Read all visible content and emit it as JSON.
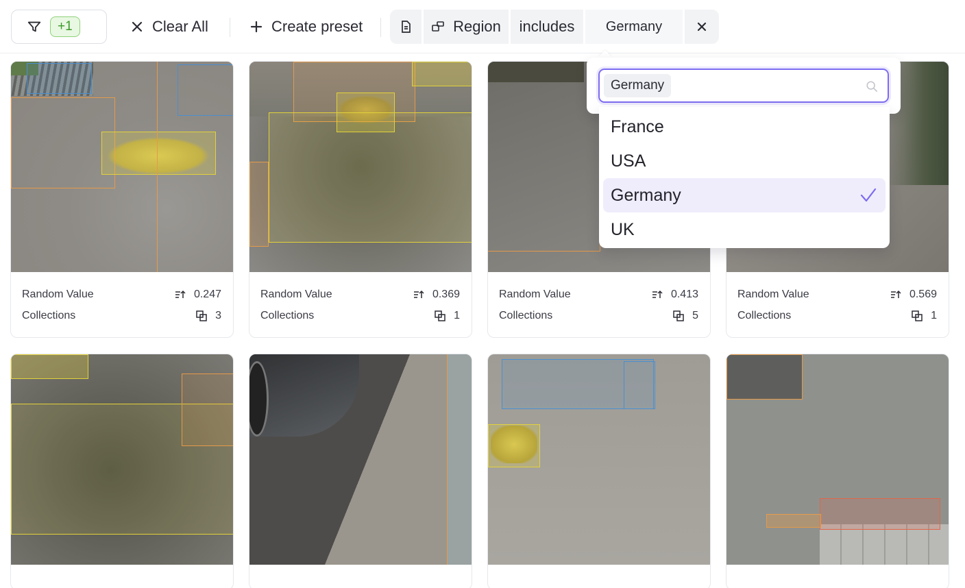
{
  "toolbar": {
    "filter_count": "+1",
    "clear_all": "Clear All",
    "create_preset": "Create preset",
    "filter_chip": {
      "field": "Region",
      "operator": "includes",
      "value": "Germany"
    }
  },
  "dropdown": {
    "selected_tag": "Germany",
    "options": [
      {
        "label": "France",
        "selected": false
      },
      {
        "label": "USA",
        "selected": false
      },
      {
        "label": "Germany",
        "selected": true
      },
      {
        "label": "UK",
        "selected": false
      }
    ]
  },
  "cards": [
    {
      "metric_label": "Random Value",
      "metric_value": "0.247",
      "collections_label": "Collections",
      "collections_count": "3"
    },
    {
      "metric_label": "Random Value",
      "metric_value": "0.369",
      "collections_label": "Collections",
      "collections_count": "1"
    },
    {
      "metric_label": "Random Value",
      "metric_value": "0.413",
      "collections_label": "Collections",
      "collections_count": "5"
    },
    {
      "metric_label": "Random Value",
      "metric_value": "0.569",
      "collections_label": "Collections",
      "collections_count": "1"
    }
  ],
  "colors": {
    "accent": "#7c6cf0",
    "badge_green": "#3c9a2a",
    "bbox_yellow": "#e3d23a",
    "bbox_orange": "#e59a4a",
    "bbox_blue": "#4a8fd0"
  }
}
